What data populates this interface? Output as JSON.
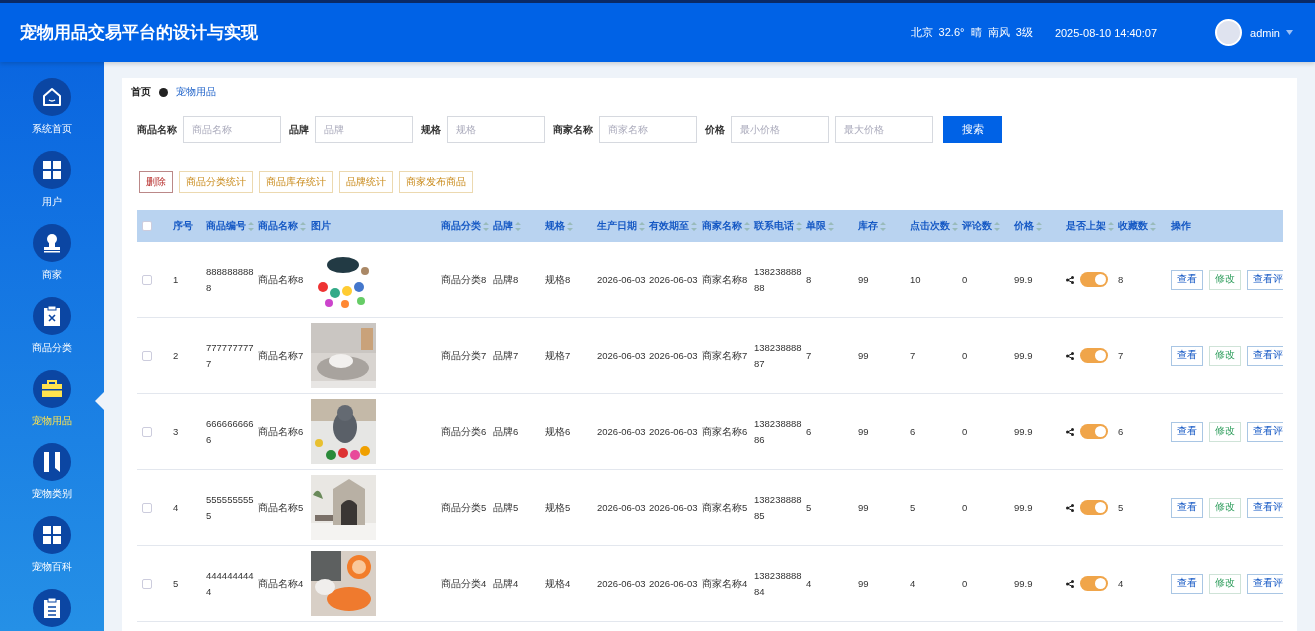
{
  "header": {
    "title": "宠物用品交易平台的设计与实现",
    "weather": "北京  32.6°  晴  南风  3级",
    "datetime": "2025-08-10 14:40:07",
    "user": "admin"
  },
  "sidebar": {
    "items": [
      {
        "label": "系统首页",
        "selected": false
      },
      {
        "label": "用户",
        "selected": false
      },
      {
        "label": "商家",
        "selected": false
      },
      {
        "label": "商品分类",
        "selected": false
      },
      {
        "label": "宠物用品",
        "selected": true
      },
      {
        "label": "宠物类别",
        "selected": false
      },
      {
        "label": "宠物百科",
        "selected": false
      },
      {
        "selected": false
      }
    ]
  },
  "breadcrumb": [
    "首页",
    "宠物用品"
  ],
  "filters": [
    {
      "label": "商品名称",
      "fields": [
        {
          "placeholder": "商品名称"
        }
      ]
    },
    {
      "label": "品牌",
      "fields": [
        {
          "placeholder": "品牌"
        }
      ]
    },
    {
      "label": "规格",
      "fields": [
        {
          "placeholder": "规格"
        }
      ]
    },
    {
      "label": "商家名称",
      "fields": [
        {
          "placeholder": "商家名称"
        }
      ]
    },
    {
      "label": "价格",
      "fields": [
        {
          "placeholder": "最小价格"
        },
        {
          "placeholder": "最大价格"
        }
      ]
    }
  ],
  "search_button": "搜索",
  "actions": [
    {
      "label": "删除",
      "kind": "danger"
    },
    {
      "label": "商品分类统计",
      "kind": "warn"
    },
    {
      "label": "商品库存统计",
      "kind": "warn"
    },
    {
      "label": "品牌统计",
      "kind": "warn"
    },
    {
      "label": "商家发布商品",
      "kind": "warn"
    }
  ],
  "table": {
    "all_checked": false,
    "columns": [
      {
        "label": "序号",
        "sortable": false
      },
      {
        "label": "商品编号",
        "sortable": true
      },
      {
        "label": "商品名称",
        "sortable": true
      },
      {
        "label": "图片",
        "sortable": false
      },
      {
        "label": "商品分类",
        "sortable": true
      },
      {
        "label": "品牌",
        "sortable": true
      },
      {
        "label": "规格",
        "sortable": true
      },
      {
        "label": "生产日期",
        "sortable": true
      },
      {
        "label": "有效期至",
        "sortable": true
      },
      {
        "label": "商家名称",
        "sortable": true
      },
      {
        "label": "联系电话",
        "sortable": true
      },
      {
        "label": "单限",
        "sortable": true
      },
      {
        "label": "库存",
        "sortable": true
      },
      {
        "label": "点击次数",
        "sortable": true
      },
      {
        "label": "评论数",
        "sortable": true
      },
      {
        "label": "价格",
        "sortable": true
      },
      {
        "label": "是否上架",
        "sortable": true
      },
      {
        "label": "收藏数",
        "sortable": true
      },
      {
        "label": "操作",
        "sortable": false
      }
    ],
    "rows": [
      {
        "checked": false,
        "cells": [
          "1",
          "8888888888",
          "商品名称8",
          {
            "kind": "picture"
          },
          "商品分类8",
          "品牌8",
          "规格8",
          "2026-06-03",
          "2026-06-03",
          "商家名称8",
          "13823888888",
          "8",
          "99",
          "10",
          "0",
          "99.9",
          {
            "kind": "toggle",
            "on": true
          },
          "8",
          {
            "kind": "buttons",
            "buttons": [
              {
                "label": "查看",
                "kind": "view"
              },
              {
                "label": "修改",
                "kind": "edit"
              },
              {
                "label": "查看评",
                "kind": "view"
              }
            ]
          }
        ]
      },
      {
        "checked": false,
        "cells": [
          "2",
          "7777777777",
          "商品名称7",
          {
            "kind": "picture"
          },
          "商品分类7",
          "品牌7",
          "规格7",
          "2026-06-03",
          "2026-06-03",
          "商家名称7",
          "13823888887",
          "7",
          "99",
          "7",
          "0",
          "99.9",
          {
            "kind": "toggle",
            "on": true
          },
          "7",
          {
            "kind": "buttons",
            "buttons": [
              {
                "label": "查看",
                "kind": "view"
              },
              {
                "label": "修改",
                "kind": "edit"
              },
              {
                "label": "查看评",
                "kind": "view"
              }
            ]
          }
        ]
      },
      {
        "checked": false,
        "cells": [
          "3",
          "6666666666",
          "商品名称6",
          {
            "kind": "picture"
          },
          "商品分类6",
          "品牌6",
          "规格6",
          "2026-06-03",
          "2026-06-03",
          "商家名称6",
          "13823888886",
          "6",
          "99",
          "6",
          "0",
          "99.9",
          {
            "kind": "toggle",
            "on": true
          },
          "6",
          {
            "kind": "buttons",
            "buttons": [
              {
                "label": "查看",
                "kind": "view"
              },
              {
                "label": "修改",
                "kind": "edit"
              },
              {
                "label": "查看评",
                "kind": "view"
              }
            ]
          }
        ]
      },
      {
        "checked": false,
        "cells": [
          "4",
          "5555555555",
          "商品名称5",
          {
            "kind": "picture"
          },
          "商品分类5",
          "品牌5",
          "规格5",
          "2026-06-03",
          "2026-06-03",
          "商家名称5",
          "13823888885",
          "5",
          "99",
          "5",
          "0",
          "99.9",
          {
            "kind": "toggle",
            "on": true
          },
          "5",
          {
            "kind": "buttons",
            "buttons": [
              {
                "label": "查看",
                "kind": "view"
              },
              {
                "label": "修改",
                "kind": "edit"
              },
              {
                "label": "查看评",
                "kind": "view"
              }
            ]
          }
        ]
      },
      {
        "checked": false,
        "cells": [
          "5",
          "4444444444",
          "商品名称4",
          {
            "kind": "picture"
          },
          "商品分类4",
          "品牌4",
          "规格4",
          "2026-06-03",
          "2026-06-03",
          "商家名称4",
          "13823888884",
          "4",
          "99",
          "4",
          "0",
          "99.9",
          {
            "kind": "toggle",
            "on": true
          },
          "4",
          {
            "kind": "buttons",
            "buttons": [
              {
                "label": "查看",
                "kind": "view"
              },
              {
                "label": "修改",
                "kind": "edit"
              },
              {
                "label": "查看评",
                "kind": "view"
              }
            ]
          }
        ]
      }
    ]
  }
}
